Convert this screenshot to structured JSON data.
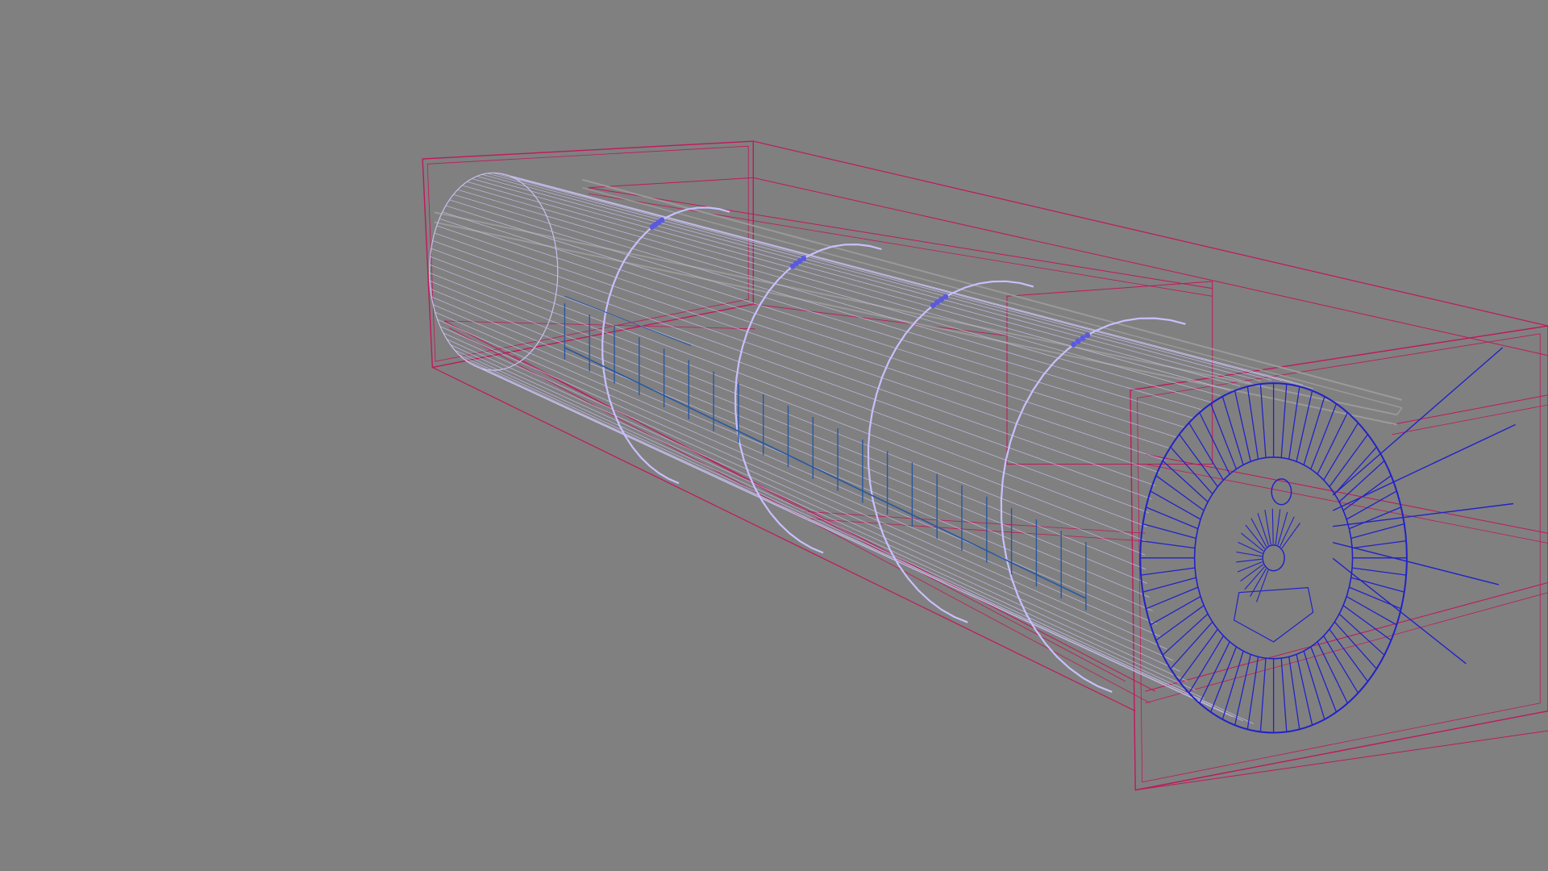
{
  "viewport": {
    "view_mode": "wireframe",
    "background_color": "#808080"
  },
  "scene": {
    "object_count": 6,
    "objects": [
      {
        "id": "outer-bounding-frame",
        "type": "wireframe-box",
        "color": "#c0185a",
        "icon": "box-wireframe-icon"
      },
      {
        "id": "tunnel-cylinder",
        "type": "wireframe-cylinder",
        "color": "#c8c0f0",
        "segments": 40,
        "icon": "cylinder-wireframe-icon"
      },
      {
        "id": "support-rings",
        "type": "selected-ring-edges",
        "color": "#c8c0ff",
        "ring_count": 4,
        "icon": "ring-icon"
      },
      {
        "id": "rail-fence",
        "type": "wireframe-railing",
        "color": "#2858a0",
        "post_count": 22,
        "icon": "railing-icon"
      },
      {
        "id": "cutter-head",
        "type": "wireframe-disc",
        "color": "#2222c8",
        "spokes": 64,
        "icon": "cutter-disc-icon"
      },
      {
        "id": "guide-beams",
        "type": "wireframe-beam",
        "color": "#9a9a9a",
        "icon": "beam-icon"
      }
    ]
  }
}
